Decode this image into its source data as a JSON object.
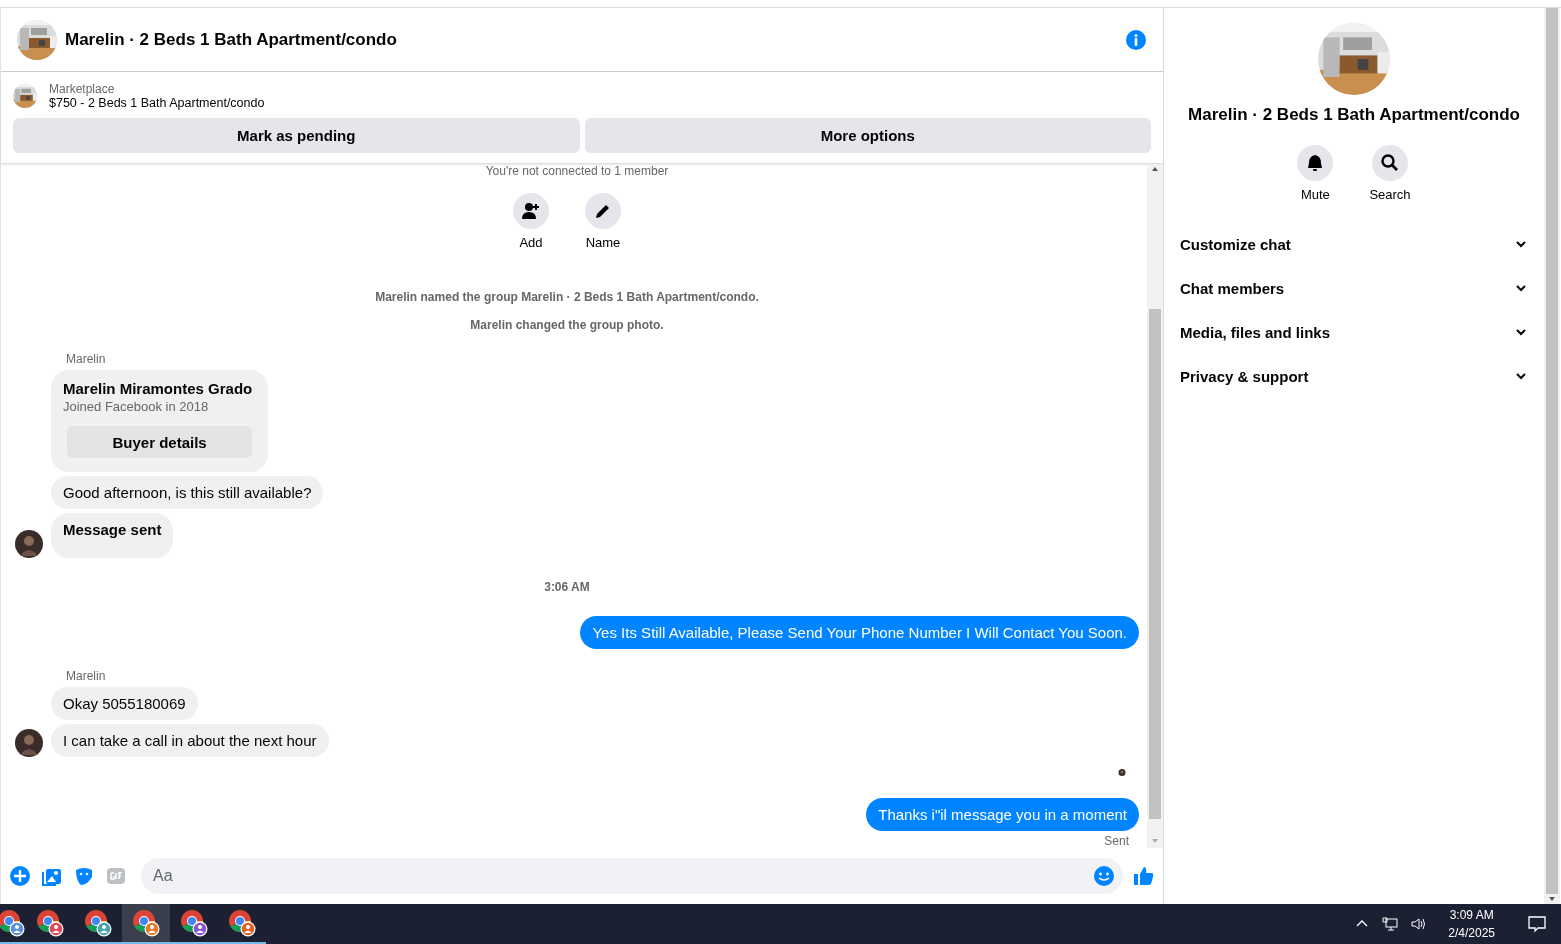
{
  "header": {
    "title": "Marelin · 2 Beds 1 Bath Apartment/condo"
  },
  "listing": {
    "source": "Marketplace",
    "title": "$750 - 2 Beds 1 Bath Apartment/condo",
    "actions": [
      "Mark as pending",
      "More options"
    ]
  },
  "chat": {
    "intro": "You're not connected to 1 member",
    "intro_actions": [
      {
        "kind": "add",
        "label": "Add"
      },
      {
        "kind": "name",
        "label": "Name"
      }
    ],
    "messages": [
      {
        "kind": "system",
        "text": "Marelin named the group Marelin · 2 Beds 1 Bath Apartment/condo."
      },
      {
        "kind": "system",
        "text": "Marelin changed the group photo."
      },
      {
        "kind": "sender",
        "text": "Marelin"
      },
      {
        "kind": "profile_card",
        "name": "Marelin Miramontes Grado",
        "subtitle": "Joined Facebook in 2018",
        "button": "Buyer details"
      },
      {
        "kind": "incoming",
        "text": "Good afternoon, is this still available?",
        "avatar": false
      },
      {
        "kind": "notice",
        "text": "Message sent",
        "avatar": true
      },
      {
        "kind": "time",
        "text": "3:06 AM"
      },
      {
        "kind": "outgoing",
        "text": "Yes Its Still Available, Please Send Your Phone Number I Will Contact You Soon."
      },
      {
        "kind": "sender",
        "text": "Marelin"
      },
      {
        "kind": "incoming",
        "text": "Okay 5055180069",
        "avatar": false
      },
      {
        "kind": "incoming",
        "text": "I can take a call in about the next hour",
        "avatar": true
      },
      {
        "kind": "read_receipt"
      },
      {
        "kind": "outgoing",
        "text": "Thanks i\"il message you in a moment"
      },
      {
        "kind": "status",
        "text": "Sent"
      }
    ]
  },
  "composer": {
    "placeholder": "Aa"
  },
  "info_panel": {
    "title": "Marelin · 2 Beds 1 Bath Apartment/condo",
    "actions": [
      {
        "kind": "mute",
        "label": "Mute"
      },
      {
        "kind": "search",
        "label": "Search"
      }
    ],
    "sections": [
      {
        "label": "Customize chat",
        "expanded": false
      },
      {
        "label": "Chat members",
        "expanded": false
      },
      {
        "label": "Media, files and links",
        "expanded": false
      },
      {
        "label": "Privacy & support",
        "expanded": false
      }
    ]
  },
  "taskbar": {
    "apps": [
      {
        "color": "#5b8fd9",
        "selected": false
      },
      {
        "color": "#e0495a",
        "selected": false
      },
      {
        "color": "#4aa3b0",
        "selected": false
      },
      {
        "color": "#e07b2e",
        "selected": true
      },
      {
        "color": "#8e55c9",
        "selected": false
      },
      {
        "color": "#e0602e",
        "selected": false
      }
    ],
    "time": "3:09 AM",
    "date": "2/4/2025"
  }
}
